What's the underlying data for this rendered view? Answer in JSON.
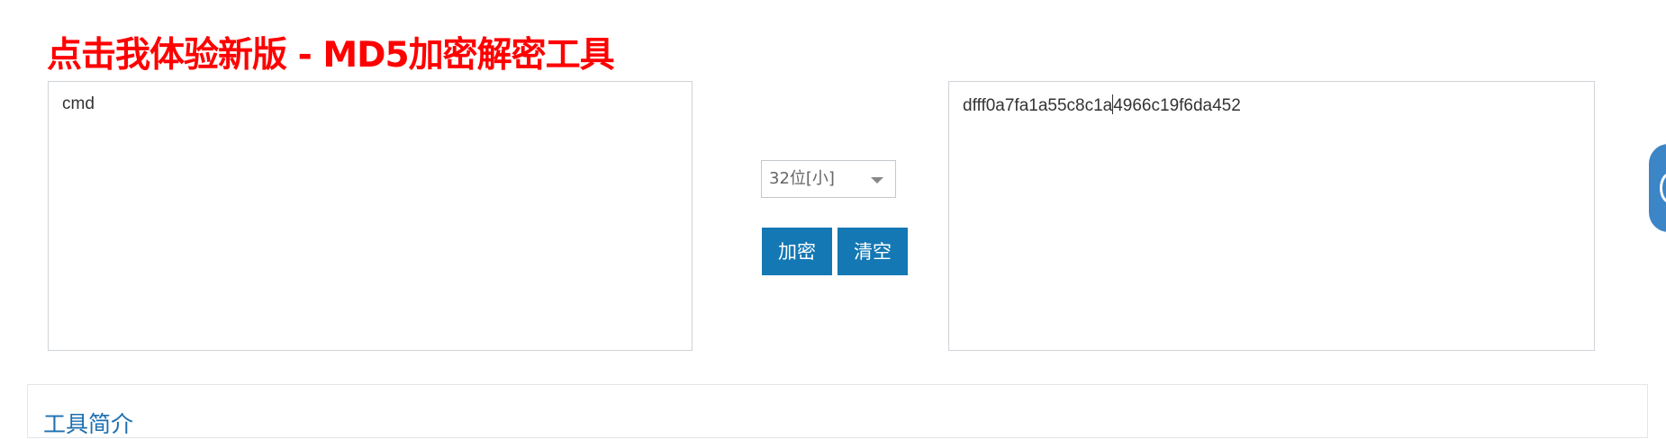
{
  "promo": {
    "link_text": "点击我体验新版 - MD5加密解密工具",
    "color": "#ff0000"
  },
  "input": {
    "value": "cmd"
  },
  "output": {
    "value_before_caret": "dfff0a7fa1a55c8c1a",
    "value_after_caret": "4966c19f6da452"
  },
  "options": {
    "hash_length_selected": "32位[小]"
  },
  "actions": {
    "encrypt_label": "加密",
    "clear_label": "清空",
    "button_color": "#1478b4"
  },
  "side_tab": {
    "icon": "chat-icon",
    "color": "#3c85c7"
  },
  "intro": {
    "title": "工具简介"
  }
}
